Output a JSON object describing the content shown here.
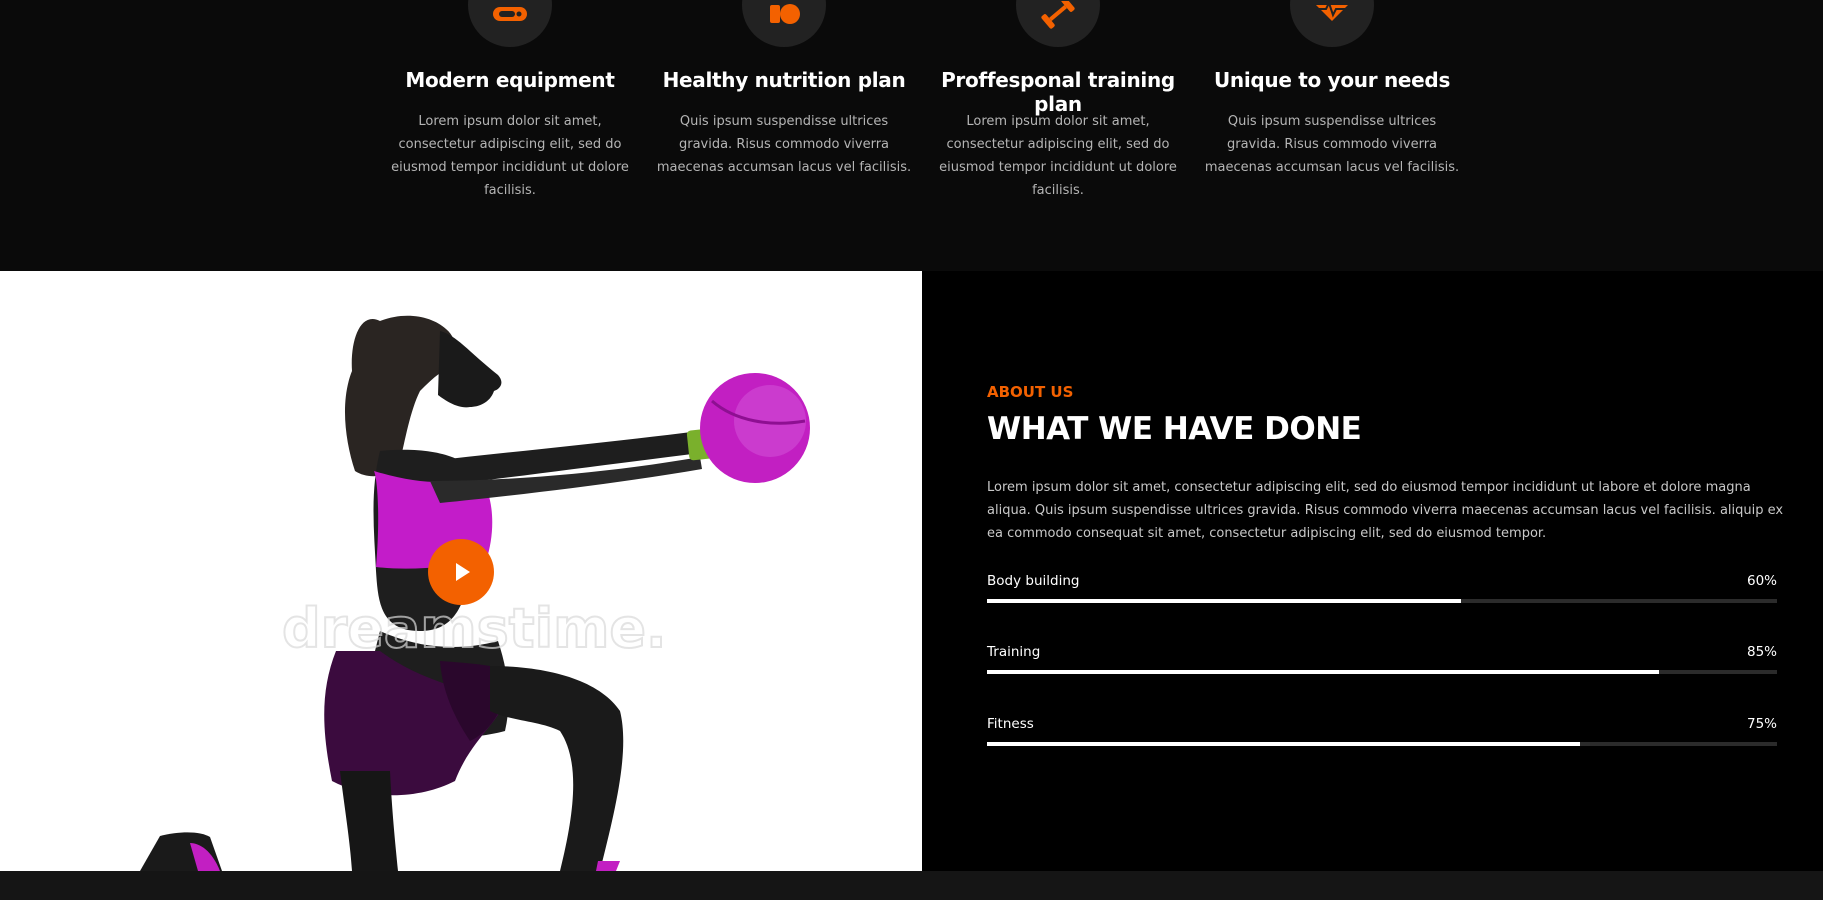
{
  "features": [
    {
      "icon": "treadmill-icon",
      "title": "Modern equipment",
      "text": "Lorem ipsum dolor sit amet, consectetur adipiscing elit, sed do eiusmod tempor incididunt ut dolore facilisis."
    },
    {
      "icon": "apple-icon",
      "title": "Healthy nutrition plan",
      "text": "Quis ipsum suspendisse ultrices gravida. Risus commodo viverra maecenas accumsan lacus vel facilisis."
    },
    {
      "icon": "dumbbell-icon",
      "title": "Proffesponal training plan",
      "text": "Lorem ipsum dolor sit amet, consectetur adipiscing elit, sed do eiusmod tempor incididunt ut dolore facilisis."
    },
    {
      "icon": "heartbeat-icon",
      "title": "Unique to your needs",
      "text": "Quis ipsum suspendisse ultrices gravida. Risus commodo viverra maecenas accumsan lacus vel facilisis."
    }
  ],
  "about": {
    "label": "ABOUT US",
    "title": "WHAT WE HAVE DONE",
    "text": "Lorem ipsum dolor sit amet, consectetur adipiscing elit, sed do eiusmod tempor incididunt ut labore et dolore magna aliqua. Quis ipsum suspendisse ultrices gravida. Risus commodo viverra maecenas accumsan lacus vel facilisis. aliquip ex ea commodo consequat sit amet, consectetur adipiscing elit, sed do eiusmod tempor.",
    "skills": [
      {
        "name": "Body building",
        "value_label": "60%",
        "percent": 60
      },
      {
        "name": "Training",
        "value_label": "85%",
        "percent": 85
      },
      {
        "name": "Fitness",
        "value_label": "75%",
        "percent": 75
      }
    ]
  },
  "media": {
    "play_icon": "play-icon",
    "watermark": "dreamstime."
  },
  "colors": {
    "accent": "#f36100",
    "bg_dark": "#0a0a0a",
    "bg_black": "#000000",
    "bar_track": "#2b2b2b",
    "magenta": "#c21fc2"
  }
}
